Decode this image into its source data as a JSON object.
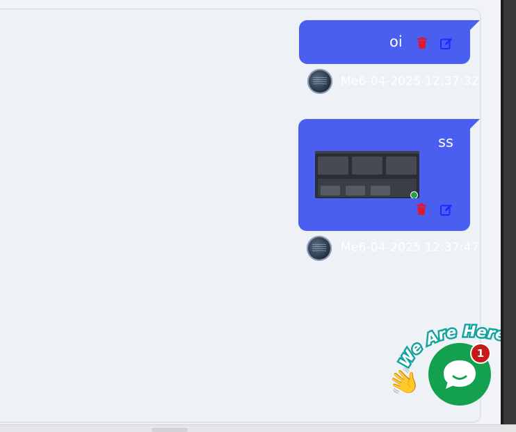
{
  "messages": [
    {
      "text": "oi",
      "sender": "Me",
      "timestamp": "6-04-2025 12:37:32",
      "actions": [
        "delete-icon",
        "edit-icon"
      ]
    },
    {
      "text": "ss",
      "sender": "Me",
      "timestamp": "6-04-2025 12:37:47",
      "attachment": "image",
      "actions": [
        "delete-icon",
        "edit-icon"
      ]
    }
  ],
  "chat_widget": {
    "tagline": "We Are Here!",
    "notification_count": "1",
    "icon": "chat-bubble-icon",
    "emoji": "👋"
  },
  "colors": {
    "bubble": "#4a5ef0",
    "delete": "#e0182d",
    "edit": "#1b2bff",
    "widget": "#13a04f",
    "badge": "#c61a1a"
  }
}
